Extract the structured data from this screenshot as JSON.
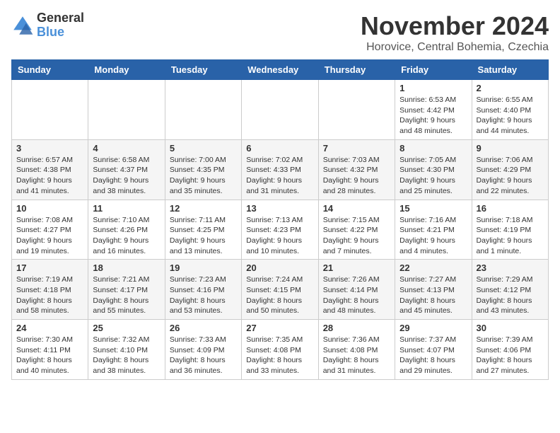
{
  "header": {
    "logo_general": "General",
    "logo_blue": "Blue",
    "month_title": "November 2024",
    "location": "Horovice, Central Bohemia, Czechia"
  },
  "calendar": {
    "weekdays": [
      "Sunday",
      "Monday",
      "Tuesday",
      "Wednesday",
      "Thursday",
      "Friday",
      "Saturday"
    ],
    "weeks": [
      [
        {
          "day": "",
          "info": ""
        },
        {
          "day": "",
          "info": ""
        },
        {
          "day": "",
          "info": ""
        },
        {
          "day": "",
          "info": ""
        },
        {
          "day": "",
          "info": ""
        },
        {
          "day": "1",
          "info": "Sunrise: 6:53 AM\nSunset: 4:42 PM\nDaylight: 9 hours and 48 minutes."
        },
        {
          "day": "2",
          "info": "Sunrise: 6:55 AM\nSunset: 4:40 PM\nDaylight: 9 hours and 44 minutes."
        }
      ],
      [
        {
          "day": "3",
          "info": "Sunrise: 6:57 AM\nSunset: 4:38 PM\nDaylight: 9 hours and 41 minutes."
        },
        {
          "day": "4",
          "info": "Sunrise: 6:58 AM\nSunset: 4:37 PM\nDaylight: 9 hours and 38 minutes."
        },
        {
          "day": "5",
          "info": "Sunrise: 7:00 AM\nSunset: 4:35 PM\nDaylight: 9 hours and 35 minutes."
        },
        {
          "day": "6",
          "info": "Sunrise: 7:02 AM\nSunset: 4:33 PM\nDaylight: 9 hours and 31 minutes."
        },
        {
          "day": "7",
          "info": "Sunrise: 7:03 AM\nSunset: 4:32 PM\nDaylight: 9 hours and 28 minutes."
        },
        {
          "day": "8",
          "info": "Sunrise: 7:05 AM\nSunset: 4:30 PM\nDaylight: 9 hours and 25 minutes."
        },
        {
          "day": "9",
          "info": "Sunrise: 7:06 AM\nSunset: 4:29 PM\nDaylight: 9 hours and 22 minutes."
        }
      ],
      [
        {
          "day": "10",
          "info": "Sunrise: 7:08 AM\nSunset: 4:27 PM\nDaylight: 9 hours and 19 minutes."
        },
        {
          "day": "11",
          "info": "Sunrise: 7:10 AM\nSunset: 4:26 PM\nDaylight: 9 hours and 16 minutes."
        },
        {
          "day": "12",
          "info": "Sunrise: 7:11 AM\nSunset: 4:25 PM\nDaylight: 9 hours and 13 minutes."
        },
        {
          "day": "13",
          "info": "Sunrise: 7:13 AM\nSunset: 4:23 PM\nDaylight: 9 hours and 10 minutes."
        },
        {
          "day": "14",
          "info": "Sunrise: 7:15 AM\nSunset: 4:22 PM\nDaylight: 9 hours and 7 minutes."
        },
        {
          "day": "15",
          "info": "Sunrise: 7:16 AM\nSunset: 4:21 PM\nDaylight: 9 hours and 4 minutes."
        },
        {
          "day": "16",
          "info": "Sunrise: 7:18 AM\nSunset: 4:19 PM\nDaylight: 9 hours and 1 minute."
        }
      ],
      [
        {
          "day": "17",
          "info": "Sunrise: 7:19 AM\nSunset: 4:18 PM\nDaylight: 8 hours and 58 minutes."
        },
        {
          "day": "18",
          "info": "Sunrise: 7:21 AM\nSunset: 4:17 PM\nDaylight: 8 hours and 55 minutes."
        },
        {
          "day": "19",
          "info": "Sunrise: 7:23 AM\nSunset: 4:16 PM\nDaylight: 8 hours and 53 minutes."
        },
        {
          "day": "20",
          "info": "Sunrise: 7:24 AM\nSunset: 4:15 PM\nDaylight: 8 hours and 50 minutes."
        },
        {
          "day": "21",
          "info": "Sunrise: 7:26 AM\nSunset: 4:14 PM\nDaylight: 8 hours and 48 minutes."
        },
        {
          "day": "22",
          "info": "Sunrise: 7:27 AM\nSunset: 4:13 PM\nDaylight: 8 hours and 45 minutes."
        },
        {
          "day": "23",
          "info": "Sunrise: 7:29 AM\nSunset: 4:12 PM\nDaylight: 8 hours and 43 minutes."
        }
      ],
      [
        {
          "day": "24",
          "info": "Sunrise: 7:30 AM\nSunset: 4:11 PM\nDaylight: 8 hours and 40 minutes."
        },
        {
          "day": "25",
          "info": "Sunrise: 7:32 AM\nSunset: 4:10 PM\nDaylight: 8 hours and 38 minutes."
        },
        {
          "day": "26",
          "info": "Sunrise: 7:33 AM\nSunset: 4:09 PM\nDaylight: 8 hours and 36 minutes."
        },
        {
          "day": "27",
          "info": "Sunrise: 7:35 AM\nSunset: 4:08 PM\nDaylight: 8 hours and 33 minutes."
        },
        {
          "day": "28",
          "info": "Sunrise: 7:36 AM\nSunset: 4:08 PM\nDaylight: 8 hours and 31 minutes."
        },
        {
          "day": "29",
          "info": "Sunrise: 7:37 AM\nSunset: 4:07 PM\nDaylight: 8 hours and 29 minutes."
        },
        {
          "day": "30",
          "info": "Sunrise: 7:39 AM\nSunset: 4:06 PM\nDaylight: 8 hours and 27 minutes."
        }
      ]
    ]
  }
}
